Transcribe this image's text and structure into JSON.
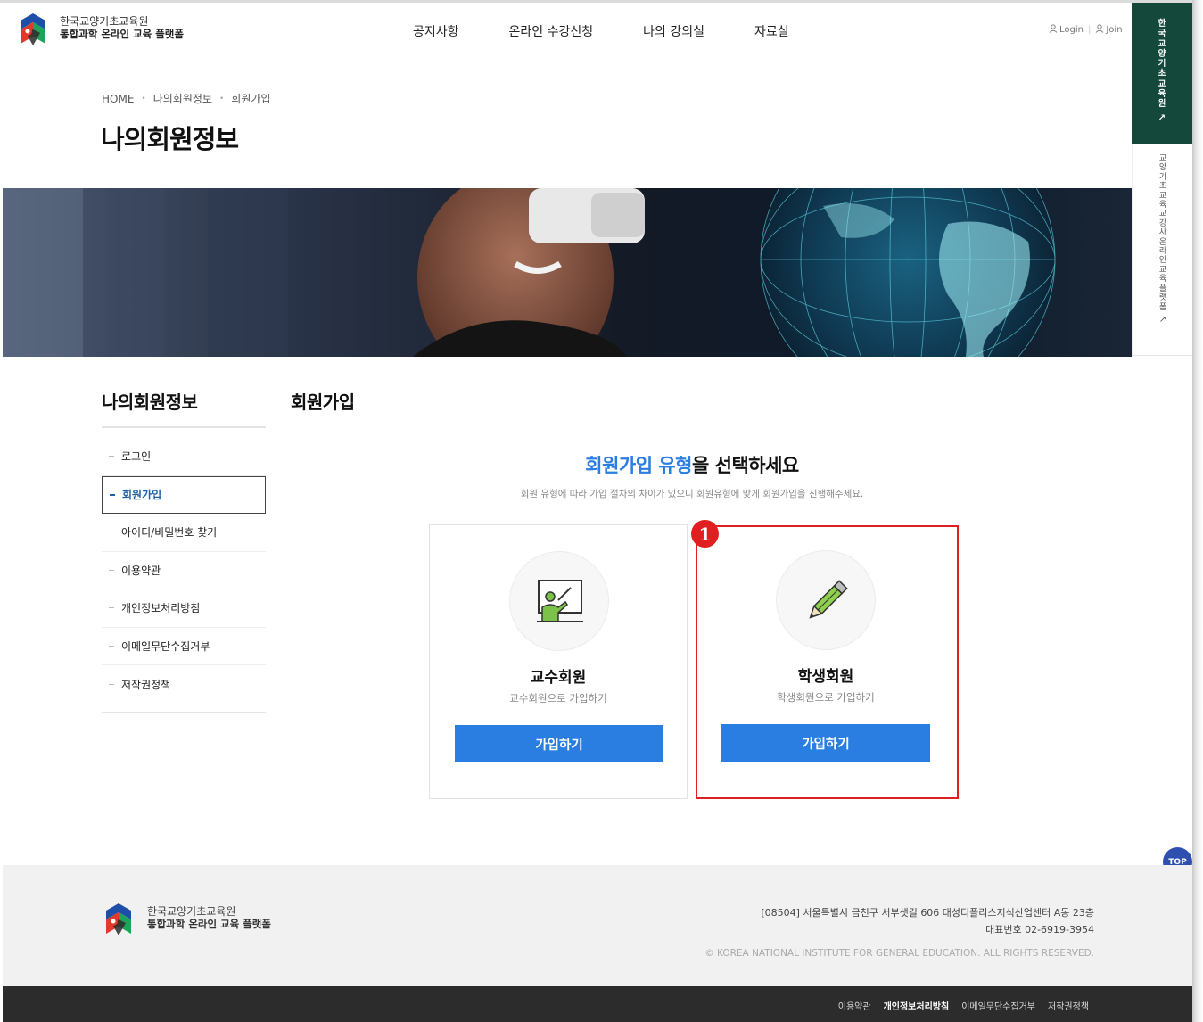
{
  "header": {
    "logo_line1": "한국교양기초교육원",
    "logo_line2": "통합과학 온라인 교육 플랫폼",
    "nav": [
      "공지사항",
      "온라인 수강신청",
      "나의 강의실",
      "자료실"
    ],
    "login": "Login",
    "join": "Join"
  },
  "side_banners": {
    "top": [
      "한",
      "국",
      "교",
      "양",
      "기",
      "초",
      "교",
      "육",
      "원"
    ],
    "bottom": [
      "교",
      "양",
      "기",
      "초",
      "교",
      "육",
      "교",
      "강",
      "사",
      "온",
      "라",
      "인",
      "교",
      "육",
      "플",
      "랫",
      "폼"
    ]
  },
  "breadcrumb": [
    "HOME",
    "나의회원정보",
    "회원가입"
  ],
  "page_title": "나의회원정보",
  "lnb": {
    "title": "나의회원정보",
    "items": [
      "로그인",
      "회원가입",
      "아이디/비밀번호 찾기",
      "이용약관",
      "개인정보처리방침",
      "이메일무단수집거부",
      "저작권정책"
    ],
    "active_index": 1
  },
  "content": {
    "title": "회원가입",
    "headline_highlight": "회원가입 유형",
    "headline_rest": "을 선택하세요",
    "subline": "회원 유형에 따라 가입 절차의 차이가 있으니 회원유형에 맞게 회원가입을 진행해주세요.",
    "cards": [
      {
        "name": "교수회원",
        "desc": "교수회원으로 가입하기",
        "button": "가입하기"
      },
      {
        "name": "학생회원",
        "desc": "학생회원으로 가입하기",
        "button": "가입하기"
      }
    ],
    "callout": "1"
  },
  "top_button": "TOP",
  "footer": {
    "logo_line1": "한국교양기초교육원",
    "logo_line2": "통합과학 온라인 교육 플랫폼",
    "address": "[08504] 서울특별시 금천구 서부샛길 606 대성디폴리스지식산업센터 A동 23층",
    "phone": "대표번호 02-6919-3954",
    "copyright": "© KOREA NATIONAL INSTITUTE FOR GENERAL EDUCATION. ALL RIGHTS RESERVED.",
    "links": [
      "이용약관",
      "개인정보처리방침",
      "이메일무단수집거부",
      "저작권정책"
    ]
  },
  "colors": {
    "accent": "#2a7de1",
    "side_banner": "#14483a",
    "highlight": "#e02020",
    "footer_bar": "#2c2c2c"
  }
}
